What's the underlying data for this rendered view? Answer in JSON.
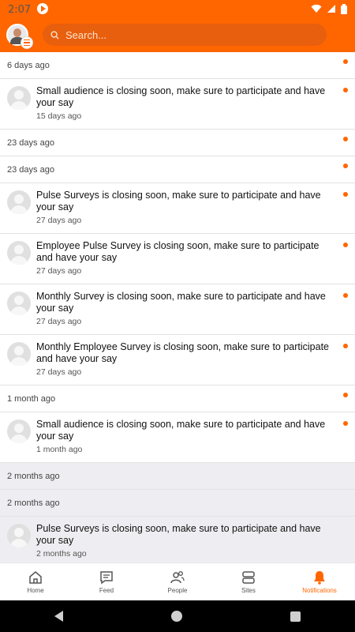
{
  "status_bar": {
    "time": "2:07"
  },
  "header": {
    "search_placeholder": "Search..."
  },
  "feed": [
    {
      "kind": "header",
      "time": "6 days ago",
      "unread": true,
      "grey": false
    },
    {
      "kind": "item",
      "message": "Small audience is closing soon, make sure to participate and have your say",
      "time": "15 days ago",
      "unread": true,
      "grey": false
    },
    {
      "kind": "header",
      "time": "23 days ago",
      "unread": true,
      "grey": false
    },
    {
      "kind": "header",
      "time": "23 days ago",
      "unread": true,
      "grey": false
    },
    {
      "kind": "item",
      "message": "Pulse Surveys is closing soon, make sure to participate and have your say",
      "time": "27 days ago",
      "unread": true,
      "grey": false
    },
    {
      "kind": "item",
      "message": "Employee Pulse Survey is closing soon, make sure to participate and have your say",
      "time": "27 days ago",
      "unread": true,
      "grey": false
    },
    {
      "kind": "item",
      "message": "Monthly Survey is closing soon, make sure to participate and have your say",
      "time": "27 days ago",
      "unread": true,
      "grey": false
    },
    {
      "kind": "item",
      "message": "Monthly Employee Survey is closing soon, make sure to participate and have your say",
      "time": "27 days ago",
      "unread": true,
      "grey": false
    },
    {
      "kind": "header",
      "time": "1 month ago",
      "unread": true,
      "grey": false
    },
    {
      "kind": "item",
      "message": "Small audience is closing soon, make sure to participate and have your say",
      "time": "1 month ago",
      "unread": true,
      "grey": false
    },
    {
      "kind": "header",
      "time": "2 months ago",
      "unread": false,
      "grey": true
    },
    {
      "kind": "header",
      "time": "2 months ago",
      "unread": false,
      "grey": true
    },
    {
      "kind": "item",
      "message": "Pulse Surveys is closing soon, make sure to participate and have your say",
      "time": "2 months ago",
      "unread": false,
      "grey": true
    }
  ],
  "nav": {
    "items": [
      {
        "label": "Home",
        "icon": "home-icon",
        "active": false
      },
      {
        "label": "Feed",
        "icon": "feed-icon",
        "active": false
      },
      {
        "label": "People",
        "icon": "people-icon",
        "active": false
      },
      {
        "label": "Sites",
        "icon": "sites-icon",
        "active": false
      },
      {
        "label": "Notifications",
        "icon": "bell-icon",
        "active": true
      }
    ]
  },
  "colors": {
    "accent": "#ff6600",
    "unread_dot": "#ff6600",
    "read_background": "#eeeef2"
  }
}
